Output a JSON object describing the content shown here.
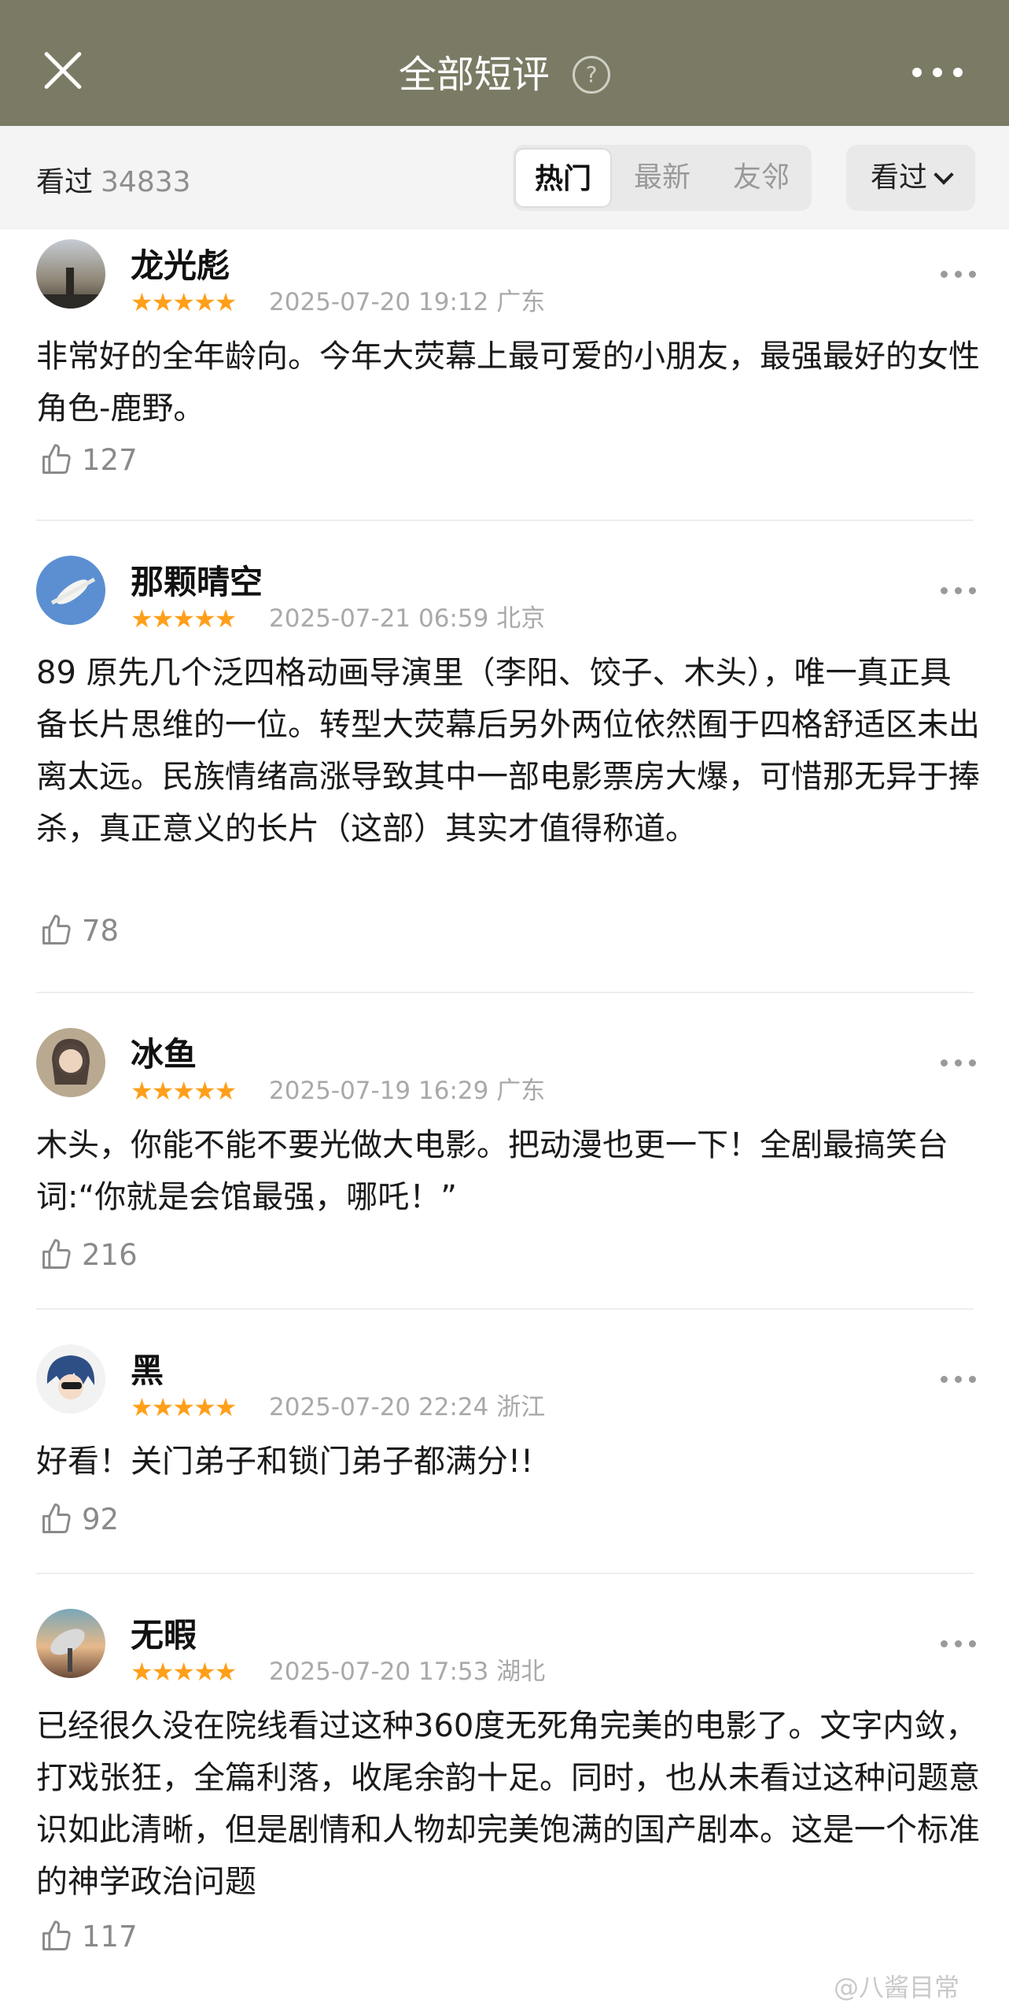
{
  "header": {
    "title": "全部短评",
    "help_glyph": "?",
    "bg_color": "#7b7b65"
  },
  "filter": {
    "watched_label": "看过",
    "watched_count": "34833",
    "tabs": [
      {
        "label": "热门",
        "active": true
      },
      {
        "label": "最新",
        "active": false
      },
      {
        "label": "友邻",
        "active": false
      }
    ],
    "sort_label": "看过"
  },
  "reviews": [
    {
      "user": "龙光彪",
      "stars": "★★★★★",
      "rating": 5,
      "time": "2025-07-20 19:12",
      "location": "广东",
      "text": "非常好的全年龄向。今年大荧幕上最可爱的小朋友，最强最好的女性角色-鹿野。",
      "likes": "127"
    },
    {
      "user": "那颗晴空",
      "stars": "★★★★★",
      "rating": 5,
      "time": "2025-07-21 06:59",
      "location": "北京",
      "text": "89  原先几个泛四格动画导演里（李阳、饺子、木头），唯一真正具备长片思维的一位。转型大荧幕后另外两位依然囿于四格舒适区未出离太远。民族情绪高涨导致其中一部电影票房大爆，可惜那无异于捧杀，真正意义的长片（这部）其实才值得称道。",
      "likes": "78"
    },
    {
      "user": "冰鱼",
      "stars": "★★★★★",
      "rating": 5,
      "time": "2025-07-19 16:29",
      "location": "广东",
      "text": "木头，你能不能不要光做大电影。把动漫也更一下！全剧最搞笑台词:“你就是会馆最强，哪吒！”",
      "likes": "216"
    },
    {
      "user": "黑",
      "stars": "★★★★★",
      "rating": 5,
      "time": "2025-07-20 22:24",
      "location": "浙江",
      "text": "好看！关门弟子和锁门弟子都满分!!",
      "likes": "92"
    },
    {
      "user": "无暇",
      "stars": "★★★★★",
      "rating": 5,
      "time": "2025-07-20 17:53",
      "location": "湖北",
      "text": "已经很久没在院线看过这种360度无死角完美的电影了。文字内敛，打戏张狂，全篇利落，收尾余韵十足。同时，也从未看过这种问题意识如此清晰，但是剧情和人物却完美饱满的国产剧本。这是一个标准的神学政治问题",
      "likes": "117"
    }
  ],
  "watermark": "@八酱目常",
  "colors": {
    "star": "#ff9f1a",
    "meta_text": "#a9a9a9"
  }
}
